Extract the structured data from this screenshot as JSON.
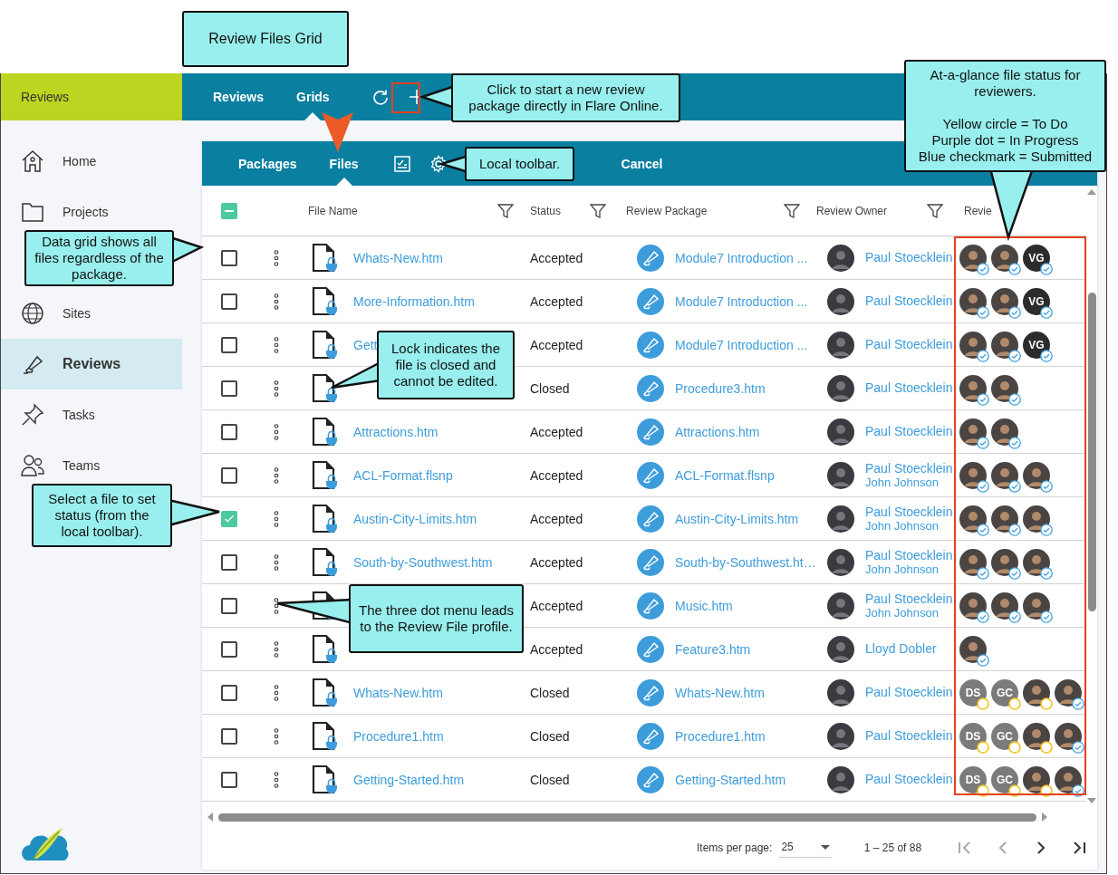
{
  "app_bar": {
    "section": "Reviews",
    "tabs": [
      {
        "label": "Reviews",
        "selected": false
      },
      {
        "label": "Grids",
        "selected": true
      }
    ]
  },
  "sidebar": {
    "items": [
      {
        "label": "Home",
        "selected": false
      },
      {
        "label": "Projects",
        "selected": false
      },
      {
        "label": "Sites",
        "selected": false
      },
      {
        "label": "Reviews",
        "selected": true
      },
      {
        "label": "Tasks",
        "selected": false
      },
      {
        "label": "Teams",
        "selected": false
      }
    ]
  },
  "toolbar": {
    "tabs": [
      {
        "label": "Packages",
        "selected": false
      },
      {
        "label": "Files",
        "selected": true
      }
    ],
    "cancel": "Cancel"
  },
  "table": {
    "select_all_partial": true,
    "columns": [
      "File Name",
      "Status",
      "Review Package",
      "Review Owner",
      "Revie"
    ],
    "rows": [
      {
        "selected": false,
        "file": "Whats-New.htm",
        "status": "Accepted",
        "package": "Module7 Introduction ...",
        "owner": "Paul Stoecklein",
        "reviewers": [
          {
            "submitted": true
          },
          {
            "submitted": true
          },
          {
            "initials": "VG",
            "submitted": true
          }
        ]
      },
      {
        "selected": false,
        "file": "More-Information.htm",
        "status": "Accepted",
        "package": "Module7 Introduction ...",
        "owner": "Paul Stoecklein",
        "reviewers": [
          {
            "submitted": true
          },
          {
            "submitted": true
          },
          {
            "initials": "VG",
            "submitted": true
          }
        ]
      },
      {
        "selected": false,
        "file": "Gett",
        "status": "Accepted",
        "package": "Module7 Introduction ...",
        "owner": "Paul Stoecklein",
        "reviewers": [
          {
            "submitted": true
          },
          {
            "submitted": true
          },
          {
            "initials": "VG",
            "submitted": true
          }
        ]
      },
      {
        "selected": false,
        "status": "Closed",
        "package": "Procedure3.htm",
        "owner": "Paul Stoecklein",
        "reviewers": [
          {
            "submitted": true
          },
          {
            "submitted": true
          }
        ]
      },
      {
        "selected": false,
        "file": "Attractions.htm",
        "status": "Accepted",
        "package": "Attractions.htm",
        "owner": "Paul Stoecklein",
        "reviewers": [
          {
            "submitted": true
          },
          {
            "submitted": true
          }
        ]
      },
      {
        "selected": false,
        "file": "ACL-Format.flsnp",
        "status": "Accepted",
        "package": "ACL-Format.flsnp",
        "owner": "Paul Stoecklein",
        "owner_tooltip": "John Johnson",
        "reviewers": [
          {
            "submitted": true
          },
          {
            "submitted": true
          },
          {
            "submitted": true
          }
        ]
      },
      {
        "selected": true,
        "file": "Austin-City-Limits.htm",
        "status": "Accepted",
        "package": "Austin-City-Limits.htm",
        "owner": "Paul Stoecklein",
        "owner_tooltip": "John Johnson",
        "reviewers": [
          {
            "submitted": true
          },
          {
            "submitted": true
          },
          {
            "submitted": true
          }
        ]
      },
      {
        "selected": false,
        "file": "South-by-Southwest.htm",
        "status": "Accepted",
        "package": "South-by-Southwest.ht…",
        "owner": "Paul Stoecklein",
        "owner_tooltip": "John Johnson",
        "reviewers": [
          {
            "submitted": true
          },
          {
            "submitted": true
          },
          {
            "submitted": true
          }
        ]
      },
      {
        "selected": false,
        "status": "Accepted",
        "package": "Music.htm",
        "owner": "Paul Stoecklein",
        "owner_tooltip": "John Johnson",
        "reviewers": [
          {
            "submitted": true
          },
          {
            "submitted": true
          },
          {
            "submitted": true
          }
        ]
      },
      {
        "selected": false,
        "status": "Accepted",
        "package": "Feature3.htm",
        "owner": "Lloyd Dobler",
        "reviewers": [
          {
            "submitted": true
          }
        ]
      },
      {
        "selected": false,
        "file": "Whats-New.htm",
        "status": "Closed",
        "package": "Whats-New.htm",
        "owner": "Paul Stoecklein",
        "reviewers": [
          {
            "initials": "DS",
            "submitted": false
          },
          {
            "initials": "GC",
            "submitted": false
          },
          {
            "submitted": false
          },
          {
            "submitted": true
          }
        ]
      },
      {
        "selected": false,
        "file": "Procedure1.htm",
        "status": "Closed",
        "package": "Procedure1.htm",
        "owner": "Paul Stoecklein",
        "reviewers": [
          {
            "initials": "DS",
            "submitted": false
          },
          {
            "initials": "GC",
            "submitted": false
          },
          {
            "submitted": false
          },
          {
            "submitted": true
          }
        ]
      },
      {
        "selected": false,
        "file": "Getting-Started.htm",
        "status": "Closed",
        "package": "Getting-Started.htm",
        "owner": "Paul Stoecklein",
        "reviewers": [
          {
            "initials": "DS",
            "submitted": false
          },
          {
            "initials": "GC",
            "submitted": false
          },
          {
            "submitted": false
          },
          {
            "submitted": true
          }
        ]
      }
    ]
  },
  "pager": {
    "label": "Items per page:",
    "page_size": "25",
    "range": "1 – 25 of 88",
    "buttons": [
      {
        "disabled": true
      },
      {
        "disabled": true
      },
      {
        "disabled": false
      },
      {
        "disabled": false
      }
    ]
  },
  "callouts": [
    {
      "text": "Review Files Grid"
    },
    {
      "text": "Click to start a new review\npackage directly in Flare Online."
    },
    {
      "text": "Local toolbar."
    },
    {
      "text": "At-a-glance file status for\nreviewers.\n\nYellow circle = To Do\nPurple dot = In Progress\nBlue checkmark = Submitted"
    },
    {
      "text": "Data grid shows all\nfiles regardless of the\npackage."
    },
    {
      "text": "Lock indicates the\nfile is closed and\ncannot be edited."
    },
    {
      "text": "Select a file to set\nstatus (from the\nlocal toolbar)."
    },
    {
      "text": "The three dot menu leads\nto the Review File profile."
    }
  ]
}
